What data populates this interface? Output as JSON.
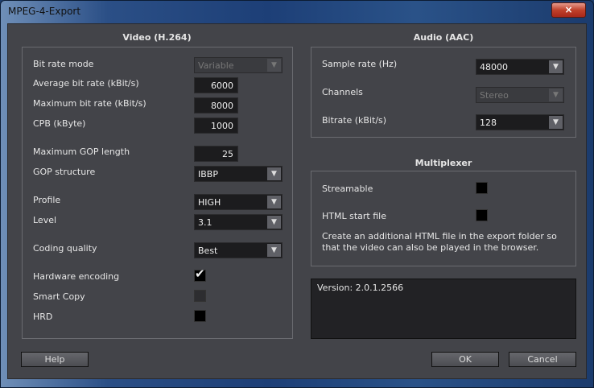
{
  "window": {
    "title": "MPEG-4-Export",
    "close_icon": "×"
  },
  "video": {
    "title": "Video (H.264)",
    "bit_rate_mode": {
      "label": "Bit rate mode",
      "value": "Variable"
    },
    "avg_bit_rate": {
      "label": "Average bit rate (kBit/s)",
      "value": "6000"
    },
    "max_bit_rate": {
      "label": "Maximum bit rate (kBit/s)",
      "value": "8000"
    },
    "cpb": {
      "label": "CPB (kByte)",
      "value": "1000"
    },
    "max_gop": {
      "label": "Maximum GOP length",
      "value": "25"
    },
    "gop_structure": {
      "label": "GOP structure",
      "value": "IBBP"
    },
    "profile": {
      "label": "Profile",
      "value": "HIGH"
    },
    "level": {
      "label": "Level",
      "value": "3.1"
    },
    "coding_quality": {
      "label": "Coding quality",
      "value": "Best"
    },
    "hardware_encoding": {
      "label": "Hardware encoding",
      "checked": true
    },
    "smart_copy": {
      "label": "Smart Copy",
      "checked": false,
      "disabled": true
    },
    "hrd": {
      "label": "HRD",
      "checked": false
    }
  },
  "audio": {
    "title": "Audio (AAC)",
    "sample_rate": {
      "label": "Sample rate (Hz)",
      "value": "48000"
    },
    "channels": {
      "label": "Channels",
      "value": "Stereo"
    },
    "bitrate": {
      "label": "Bitrate (kBit/s)",
      "value": "128"
    }
  },
  "multiplexer": {
    "title": "Multiplexer",
    "streamable": {
      "label": "Streamable",
      "checked": false
    },
    "html_start": {
      "label": "HTML start file",
      "checked": false
    },
    "description": "Create an additional HTML file in the export folder so that the video can also be played in the browser."
  },
  "version": "Version: 2.0.1.2566",
  "buttons": {
    "help": "Help",
    "ok": "OK",
    "cancel": "Cancel"
  },
  "glyphs": {
    "arrow": "▼",
    "check": "✔"
  }
}
